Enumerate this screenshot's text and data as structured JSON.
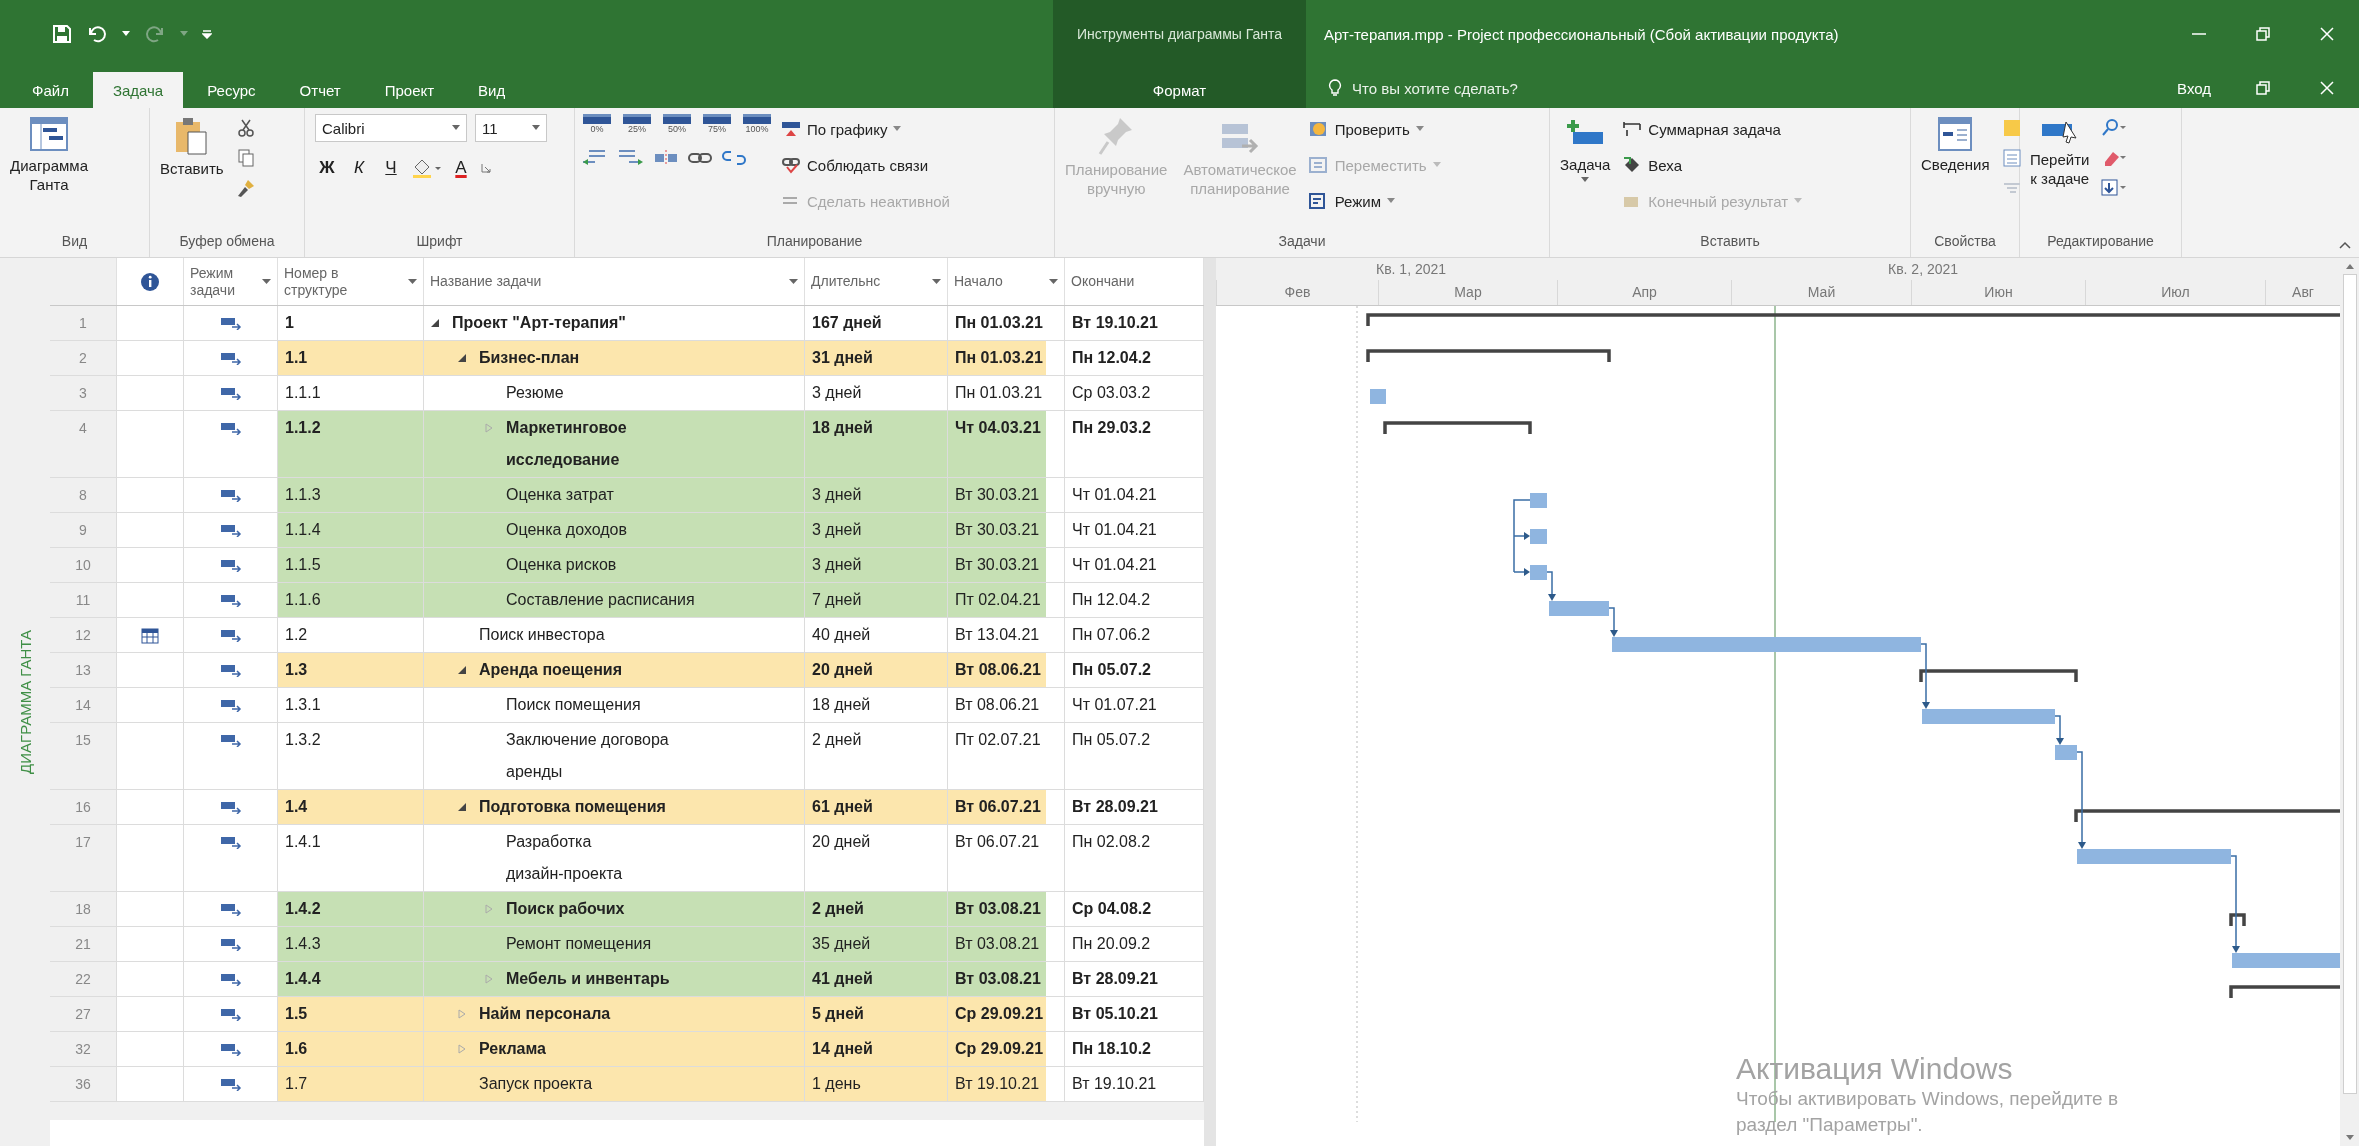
{
  "title_bar": {
    "context_title": "Инструменты диаграммы Ганта",
    "title": "Арт-терапия.mpp - Project профессиональный (Сбой активации продукта)"
  },
  "tabs": [
    {
      "label": "Файл",
      "selected": false,
      "kind": "file"
    },
    {
      "label": "Задача",
      "selected": true,
      "kind": "main"
    },
    {
      "label": "Ресурс",
      "selected": false,
      "kind": "main"
    },
    {
      "label": "Отчет",
      "selected": false,
      "kind": "main"
    },
    {
      "label": "Проект",
      "selected": false,
      "kind": "main"
    },
    {
      "label": "Вид",
      "selected": false,
      "kind": "main"
    },
    {
      "label": "Формат",
      "selected": false,
      "kind": "context"
    }
  ],
  "tell_me": {
    "placeholder": "Что вы хотите сделать?"
  },
  "sign_in": "Вход",
  "ribbon": {
    "view": {
      "label": "Вид",
      "gantt": "Диаграмма\nГанта"
    },
    "clipboard": {
      "label": "Буфер обмена",
      "paste": "Вставить"
    },
    "font": {
      "label": "Шрифт",
      "family": "Calibri",
      "size": "11",
      "bold": "Ж",
      "italic": "К",
      "underline": "Ч",
      "font_color": "А"
    },
    "schedule": {
      "label": "Планирование",
      "percents": [
        "0%",
        "25%",
        "50%",
        "75%",
        "100%"
      ],
      "on_track": "По графику",
      "respect_links": "Соблюдать связи",
      "inactivate": {
        "label": "Сделать неактивной",
        "disabled": true
      }
    },
    "tasks": {
      "label": "Задачи",
      "manual": {
        "label": "Планирование\nвручную",
        "disabled": true
      },
      "auto": {
        "label": "Автоматическое\nпланирование",
        "disabled": true
      },
      "inspect": {
        "label": "Проверить",
        "disabled": false
      },
      "move": {
        "label": "Переместить",
        "disabled": true
      },
      "mode": {
        "label": "Режим",
        "disabled": false
      }
    },
    "insert": {
      "label": "Вставить",
      "task": "Задача",
      "summary": {
        "label": "Суммарная задача",
        "disabled": false
      },
      "milestone": {
        "label": "Веха",
        "disabled": false
      },
      "deliverable": {
        "label": "Конечный результат",
        "disabled": true
      }
    },
    "properties": {
      "label": "Свойства",
      "info": "Сведения"
    },
    "editing": {
      "label": "Редактирование",
      "goto": "Перейти\nк задаче"
    }
  },
  "side_tab": "ДИАГРАММА ГАНТА",
  "table": {
    "columns": [
      {
        "label": "Режим\nзадачи",
        "filter": true
      },
      {
        "label": "Номер в\nструктуре",
        "filter": true
      },
      {
        "label": "Название задачи",
        "filter": true
      },
      {
        "label": "Длительнс",
        "filter": true
      },
      {
        "label": "Начало",
        "filter": true
      },
      {
        "label": "Окончани",
        "filter": false
      }
    ],
    "rows": [
      {
        "num": "1",
        "wbs": "1",
        "name": "Проект \"Арт-терапия\"",
        "duration": "167 дней",
        "start": "Пн 01.03.21",
        "finish": "Вт 19.10.21",
        "bold": true,
        "indicator": false,
        "kind": "summary",
        "expanded": true,
        "children": [
          {
            "num": "2",
            "wbs": "1.1",
            "name": "Бизнес-план",
            "duration": "31 дней",
            "start": "Пн 01.03.21",
            "finish": "Пн 12.04.2",
            "bold": true,
            "indicator": false,
            "color": "#fce6ad",
            "kind": "summary",
            "expanded": true,
            "children": [
              {
                "num": "3",
                "wbs": "1.1.1",
                "name": "Резюме",
                "duration": "3 дней",
                "start": "Пн 01.03.21",
                "finish": "Ср 03.03.2",
                "bold": false,
                "indicator": false,
                "kind": "task"
              },
              {
                "num": "4",
                "wbs": "1.1.2",
                "name": "Маркетинговое\nисследование",
                "duration": "18 дней",
                "start": "Чт 04.03.21",
                "finish": "Пн 29.03.2",
                "bold": true,
                "indicator": false,
                "color": "#c6e0b4",
                "kind": "summary",
                "expanded": false
              },
              {
                "num": "8",
                "wbs": "1.1.3",
                "name": "Оценка затрат",
                "duration": "3 дней",
                "start": "Вт 30.03.21",
                "finish": "Чт 01.04.21",
                "bold": false,
                "indicator": false,
                "color": "#c6e0b4",
                "kind": "task"
              },
              {
                "num": "9",
                "wbs": "1.1.4",
                "name": "Оценка доходов",
                "duration": "3 дней",
                "start": "Вт 30.03.21",
                "finish": "Чт 01.04.21",
                "bold": false,
                "indicator": false,
                "color": "#c6e0b4",
                "kind": "task"
              },
              {
                "num": "10",
                "wbs": "1.1.5",
                "name": "Оценка рисков",
                "duration": "3 дней",
                "start": "Вт 30.03.21",
                "finish": "Чт 01.04.21",
                "bold": false,
                "indicator": false,
                "color": "#c6e0b4",
                "kind": "task"
              },
              {
                "num": "11",
                "wbs": "1.1.6",
                "name": "Составление расписания",
                "duration": "7 дней",
                "start": "Пт 02.04.21",
                "finish": "Пн 12.04.2",
                "bold": false,
                "indicator": false,
                "color": "#c6e0b4",
                "kind": "task"
              }
            ]
          },
          {
            "num": "12",
            "wbs": "1.2",
            "name": "Поиск инвестора",
            "duration": "40 дней",
            "start": "Вт 13.04.21",
            "finish": "Пн 07.06.2",
            "bold": false,
            "indicator": true,
            "kind": "task"
          },
          {
            "num": "13",
            "wbs": "1.3",
            "name": "Аренда поещения",
            "duration": "20 дней",
            "start": "Вт 08.06.21",
            "finish": "Пн 05.07.2",
            "bold": true,
            "indicator": false,
            "color": "#fce6ad",
            "kind": "summary",
            "expanded": true,
            "children": [
              {
                "num": "14",
                "wbs": "1.3.1",
                "name": "Поиск помещения",
                "duration": "18 дней",
                "start": "Вт 08.06.21",
                "finish": "Чт 01.07.21",
                "bold": false,
                "indicator": false,
                "kind": "task"
              },
              {
                "num": "15",
                "wbs": "1.3.2",
                "name": "Заключение договора\nаренды",
                "duration": "2 дней",
                "start": "Пт 02.07.21",
                "finish": "Пн 05.07.2",
                "bold": false,
                "indicator": false,
                "kind": "task"
              }
            ]
          },
          {
            "num": "16",
            "wbs": "1.4",
            "name": "Подготовка помещения",
            "duration": "61 дней",
            "start": "Вт 06.07.21",
            "finish": "Вт 28.09.21",
            "bold": true,
            "indicator": false,
            "color": "#fce6ad",
            "kind": "summary",
            "expanded": true,
            "children": [
              {
                "num": "17",
                "wbs": "1.4.1",
                "name": "Разработка\nдизайн-проекта",
                "duration": "20 дней",
                "start": "Вт 06.07.21",
                "finish": "Пн 02.08.2",
                "bold": false,
                "indicator": false,
                "kind": "task"
              },
              {
                "num": "18",
                "wbs": "1.4.2",
                "name": "Поиск рабочих",
                "duration": "2 дней",
                "start": "Вт 03.08.21",
                "finish": "Ср 04.08.2",
                "bold": true,
                "indicator": false,
                "color": "#c6e0b4",
                "kind": "summary",
                "expanded": false
              },
              {
                "num": "21",
                "wbs": "1.4.3",
                "name": "Ремонт помещения",
                "duration": "35 дней",
                "start": "Вт 03.08.21",
                "finish": "Пн 20.09.2",
                "bold": false,
                "indicator": false,
                "color": "#c6e0b4",
                "kind": "task"
              },
              {
                "num": "22",
                "wbs": "1.4.4",
                "name": "Мебель и инвентарь",
                "duration": "41 дней",
                "start": "Вт 03.08.21",
                "finish": "Вт 28.09.21",
                "bold": true,
                "indicator": false,
                "color": "#c6e0b4",
                "kind": "summary",
                "expanded": false
              }
            ]
          },
          {
            "num": "27",
            "wbs": "1.5",
            "name": "Найм персонала",
            "duration": "5 дней",
            "start": "Ср 29.09.21",
            "finish": "Вт 05.10.21",
            "bold": true,
            "indicator": false,
            "color": "#fce6ad",
            "kind": "summary",
            "expanded": false
          },
          {
            "num": "32",
            "wbs": "1.6",
            "name": "Реклама",
            "duration": "14 дней",
            "start": "Ср 29.09.21",
            "finish": "Пн 18.10.2",
            "bold": true,
            "indicator": false,
            "color": "#fce6ad",
            "kind": "summary",
            "expanded": false
          },
          {
            "num": "36",
            "wbs": "1.7",
            "name": "Запуск проекта",
            "duration": "1 день",
            "start": "Вт 19.10.21",
            "finish": "Вт 19.10.21",
            "bold": false,
            "indicator": false,
            "color": "#fce6ad",
            "kind": "task"
          }
        ]
      }
    ]
  },
  "timescale": {
    "quarters": [
      "Кв. 1, 2021",
      "Кв. 2, 2021"
    ],
    "months": [
      "Фев",
      "Мар",
      "Апр",
      "Май",
      "Июн",
      "Июл",
      "Авг"
    ]
  },
  "activation": {
    "title": "Активация Windows",
    "text": "Чтобы активировать Windows, перейдите в\nраздел \"Параметры\"."
  }
}
